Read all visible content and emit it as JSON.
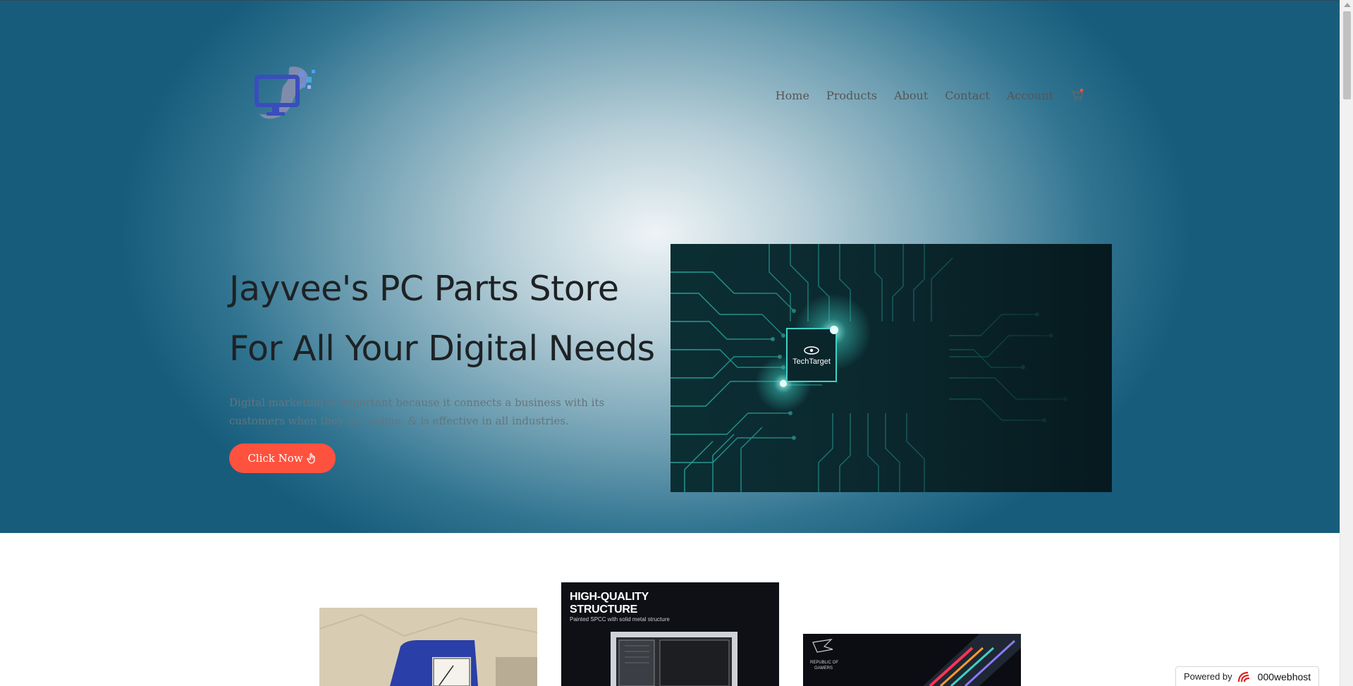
{
  "nav": {
    "items": [
      "Home",
      "Products",
      "About",
      "Contact",
      "Account"
    ],
    "cart_icon": "cart-icon"
  },
  "hero": {
    "title_line1": "Jayvee's PC Parts Store",
    "title_line2": "For All Your Digital Needs",
    "description": "Digital marketing is important because it connects a business with its customers when they are online, & is effective in all industries.",
    "button_label": "Click Now",
    "button_icon": "hand-pointer-icon",
    "image_logo_text": "TechTarget"
  },
  "products": {
    "card2_title_line1": "HIGH-QUALITY",
    "card2_title_line2": "STRUCTURE",
    "card2_subtitle": "Painted SPCC with solid metal structure",
    "card3_brand_line1": "REPUBLIC OF",
    "card3_brand_line2": "GAMERS"
  },
  "badge": {
    "powered_by": "Powered by",
    "brand": "000webhost"
  },
  "colors": {
    "accent": "#fe523f",
    "hero_dark": "#185c7c",
    "circuit": "#3fd2c6"
  }
}
